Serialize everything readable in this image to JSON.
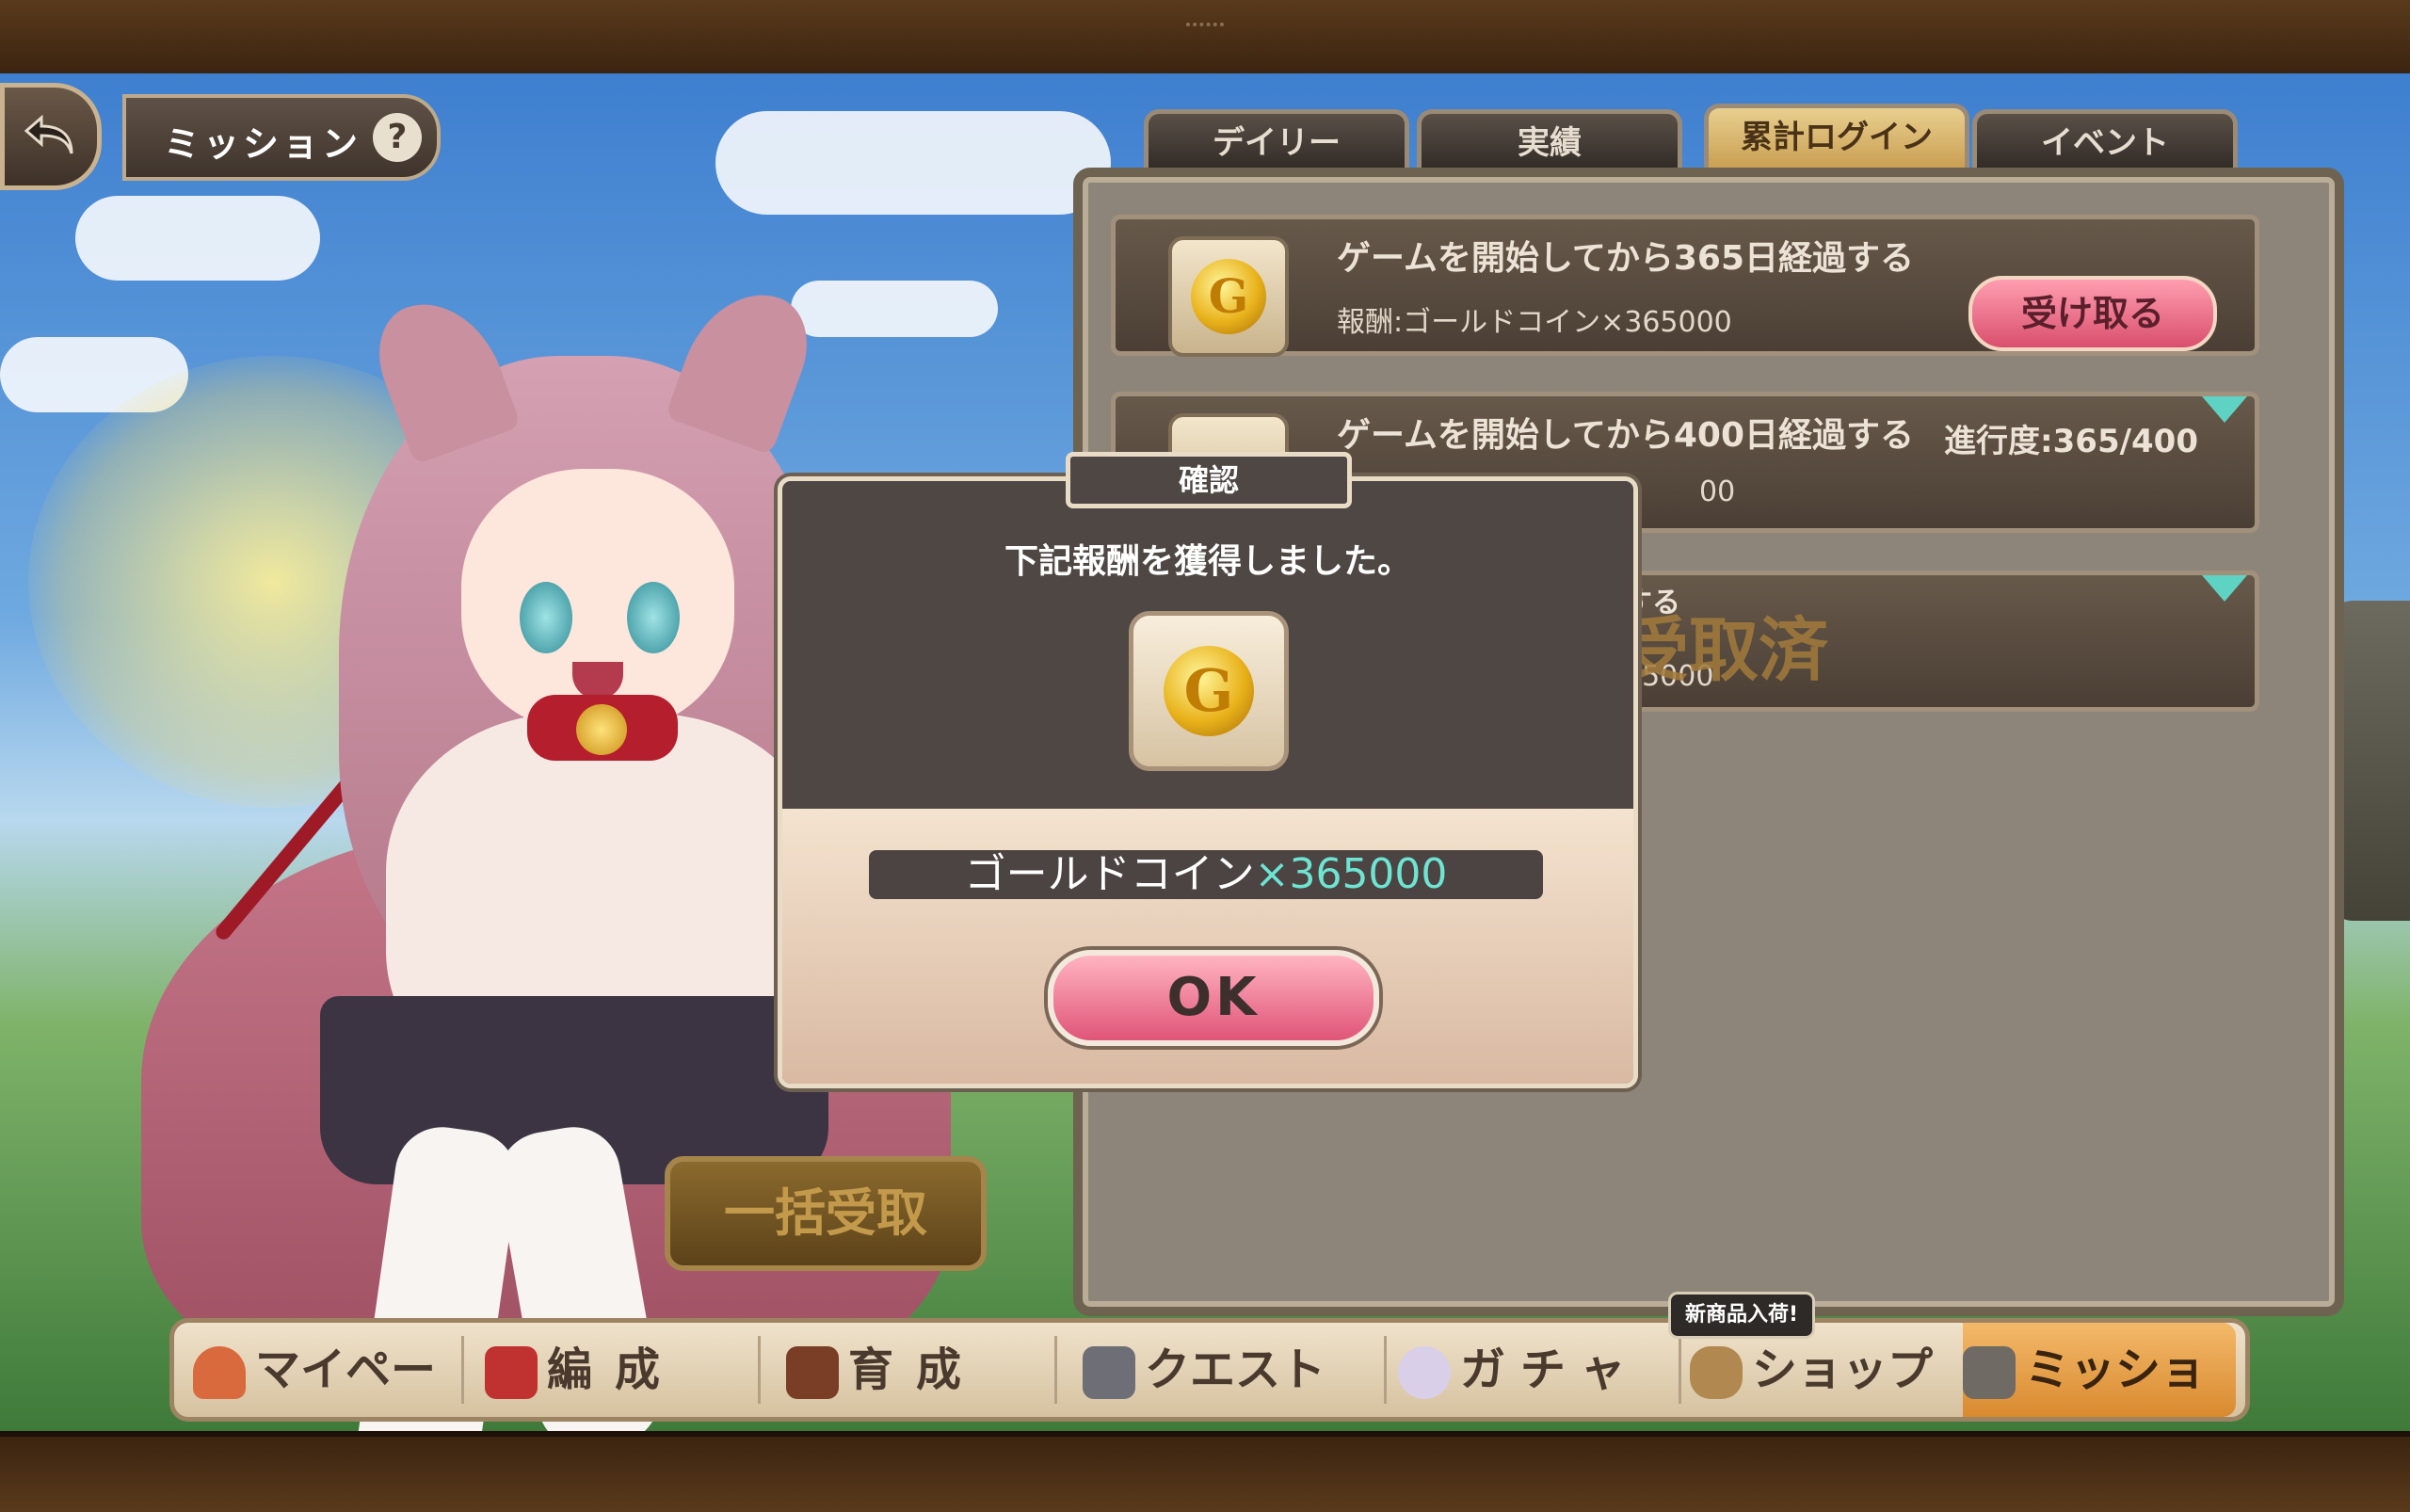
{
  "header": {
    "title": "ミッション",
    "help_label": "?"
  },
  "tabs": [
    {
      "label": "デイリー",
      "active": false
    },
    {
      "label": "実績",
      "active": false
    },
    {
      "label": "累計ログイン",
      "active": true
    },
    {
      "label": "イベント",
      "active": false
    }
  ],
  "missions": [
    {
      "title": "ゲームを開始してから365日経過する",
      "reward": "報酬:ゴールドコイン×365000",
      "action": "受け取る"
    },
    {
      "title": "ゲームを開始してから400日経過する",
      "progress": "進行度:365/400",
      "reward_partial": "00"
    },
    {
      "title_partial": "する",
      "reward_partial": "65000",
      "stamp": "受取済"
    }
  ],
  "bulk_button": "一括受取",
  "nav": {
    "items": [
      "マイページ",
      "編成",
      "育成",
      "クエスト",
      "ガチャ",
      "ショップ",
      "ミッション"
    ],
    "shop_badge": "新商品入荷!"
  },
  "modal": {
    "title": "確認",
    "message": "下記報酬を獲得しました。",
    "item_name": "ゴールドコイン",
    "multiplier": "×",
    "quantity": "365000",
    "ok_label": "OK",
    "coin_glyph": "G"
  },
  "colors": {
    "accent_pink": "#e05478",
    "quantity_teal": "#6ee4d3",
    "active_tab": "#c79a4c"
  }
}
